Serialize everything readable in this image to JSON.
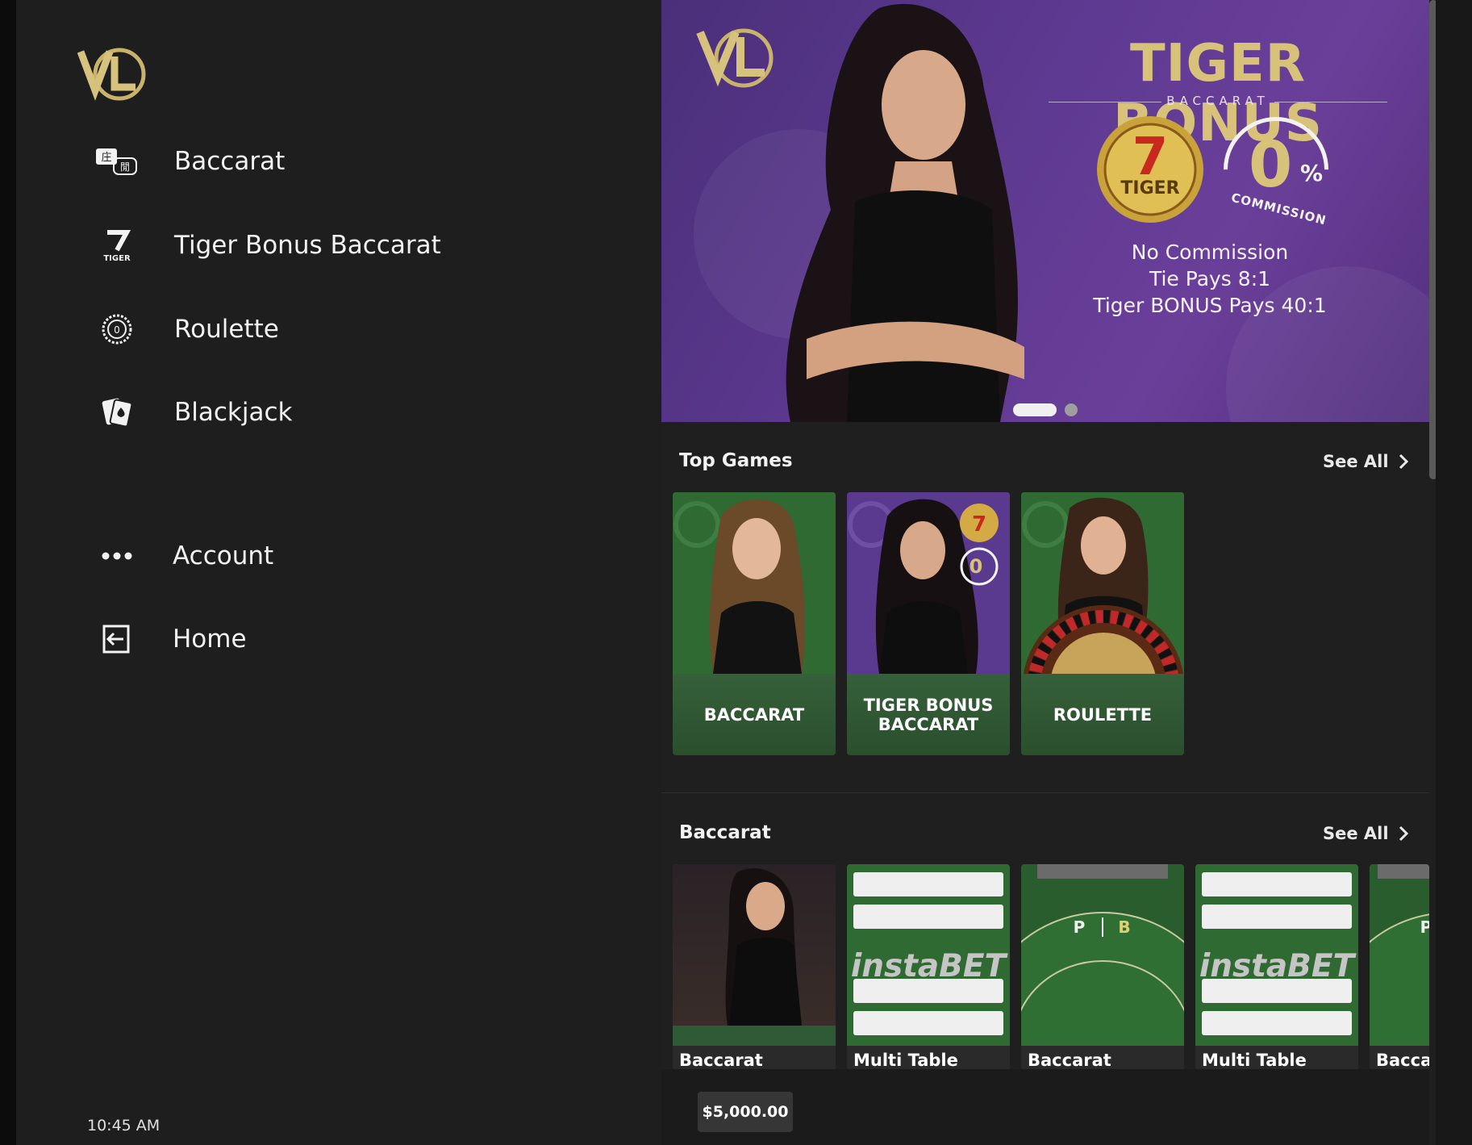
{
  "sidebar": {
    "items": [
      {
        "label": "Baccarat",
        "icon": "baccarat-icon"
      },
      {
        "label": "Tiger Bonus Baccarat",
        "icon": "tiger-icon"
      },
      {
        "label": "Roulette",
        "icon": "roulette-icon"
      },
      {
        "label": "Blackjack",
        "icon": "blackjack-icon"
      },
      {
        "label": "Account",
        "icon": "more-dots-icon"
      },
      {
        "label": "Home",
        "icon": "exit-icon"
      }
    ],
    "clock": "10:45 AM"
  },
  "banner": {
    "title": "TIGER BONUS",
    "subtitle": "BACCARAT",
    "zero": "0",
    "percent": "%",
    "commission": "COMMISSION",
    "lines": [
      "No Commission",
      "Tie Pays 8:1",
      "Tiger BONUS Pays 40:1"
    ],
    "tiger_badge": "TIGER",
    "tiger_seven": "7"
  },
  "top_games": {
    "title": "Top Games",
    "see_all": "See All",
    "cards": [
      {
        "label": "BACCARAT"
      },
      {
        "label": "TIGER BONUS BACCARAT"
      },
      {
        "label": "ROULETTE"
      }
    ]
  },
  "baccarat": {
    "title": "Baccarat",
    "see_all": "See All",
    "cards": [
      {
        "label": "Baccarat"
      },
      {
        "label": "Multi Table",
        "overlay": "instaBET"
      },
      {
        "label": "Baccarat"
      },
      {
        "label": "Multi Table",
        "overlay": "instaBET"
      },
      {
        "label": "Baccar"
      }
    ]
  },
  "balance": "$5,000.00",
  "colors": {
    "accent_gold": "#d8c27a",
    "banner_purple": "#5f3a92",
    "card_green": "#2c4f2a"
  }
}
